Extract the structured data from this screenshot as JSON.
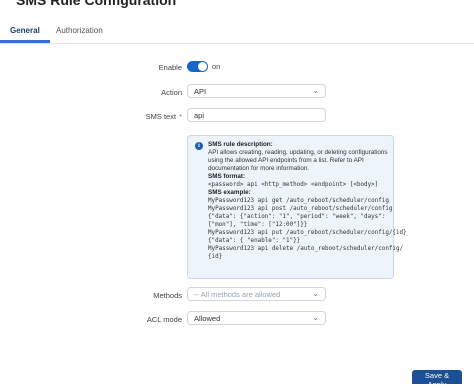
{
  "header": {
    "title": "SMS Rule Configuration"
  },
  "tabs": [
    {
      "label": "General",
      "active": true
    },
    {
      "label": "Authorization",
      "active": false
    }
  ],
  "form": {
    "enable": {
      "label": "Enable",
      "state": "on",
      "value": true
    },
    "action": {
      "label": "Action",
      "value": "API"
    },
    "sms_text": {
      "label": "SMS text",
      "required_mark": "*",
      "value": "api"
    },
    "methods": {
      "label": "Methods",
      "placeholder": "-- All methods are allowed"
    },
    "acl_mode": {
      "label": "ACL mode",
      "value": "Allowed"
    }
  },
  "info": {
    "desc_title": "SMS rule description:",
    "desc_text": "API allows creating, reading, updating, or deleting configurations using the allowed API endpoints from a list. Refer to API documentation for more information.",
    "format_title": "SMS format:",
    "format_text": "<password> api <http_method> <endpoint> [<body>]",
    "example_title": "SMS example:",
    "examples": [
      "MyPassword123 api get /auto_reboot/scheduler/config",
      "MyPassword123 api post /auto_reboot/scheduler/config",
      "{\"data\": {\"action\": \"1\", \"period\": \"week\", \"days\":",
      "[\"mon\"], \"time\": [\"12:00\"]}}",
      "MyPassword123 api put /auto_reboot/scheduler/config/{id}",
      "{\"data\": { \"enable\": \"1\"}}",
      "MyPassword123 api delete /auto_reboot/scheduler/config/",
      "{id}"
    ]
  },
  "footer": {
    "save_label": "Save & Apply"
  },
  "colors": {
    "accent": "#1b66c9",
    "save_button": "#1b4f96",
    "info_bg": "#eef4fb"
  }
}
